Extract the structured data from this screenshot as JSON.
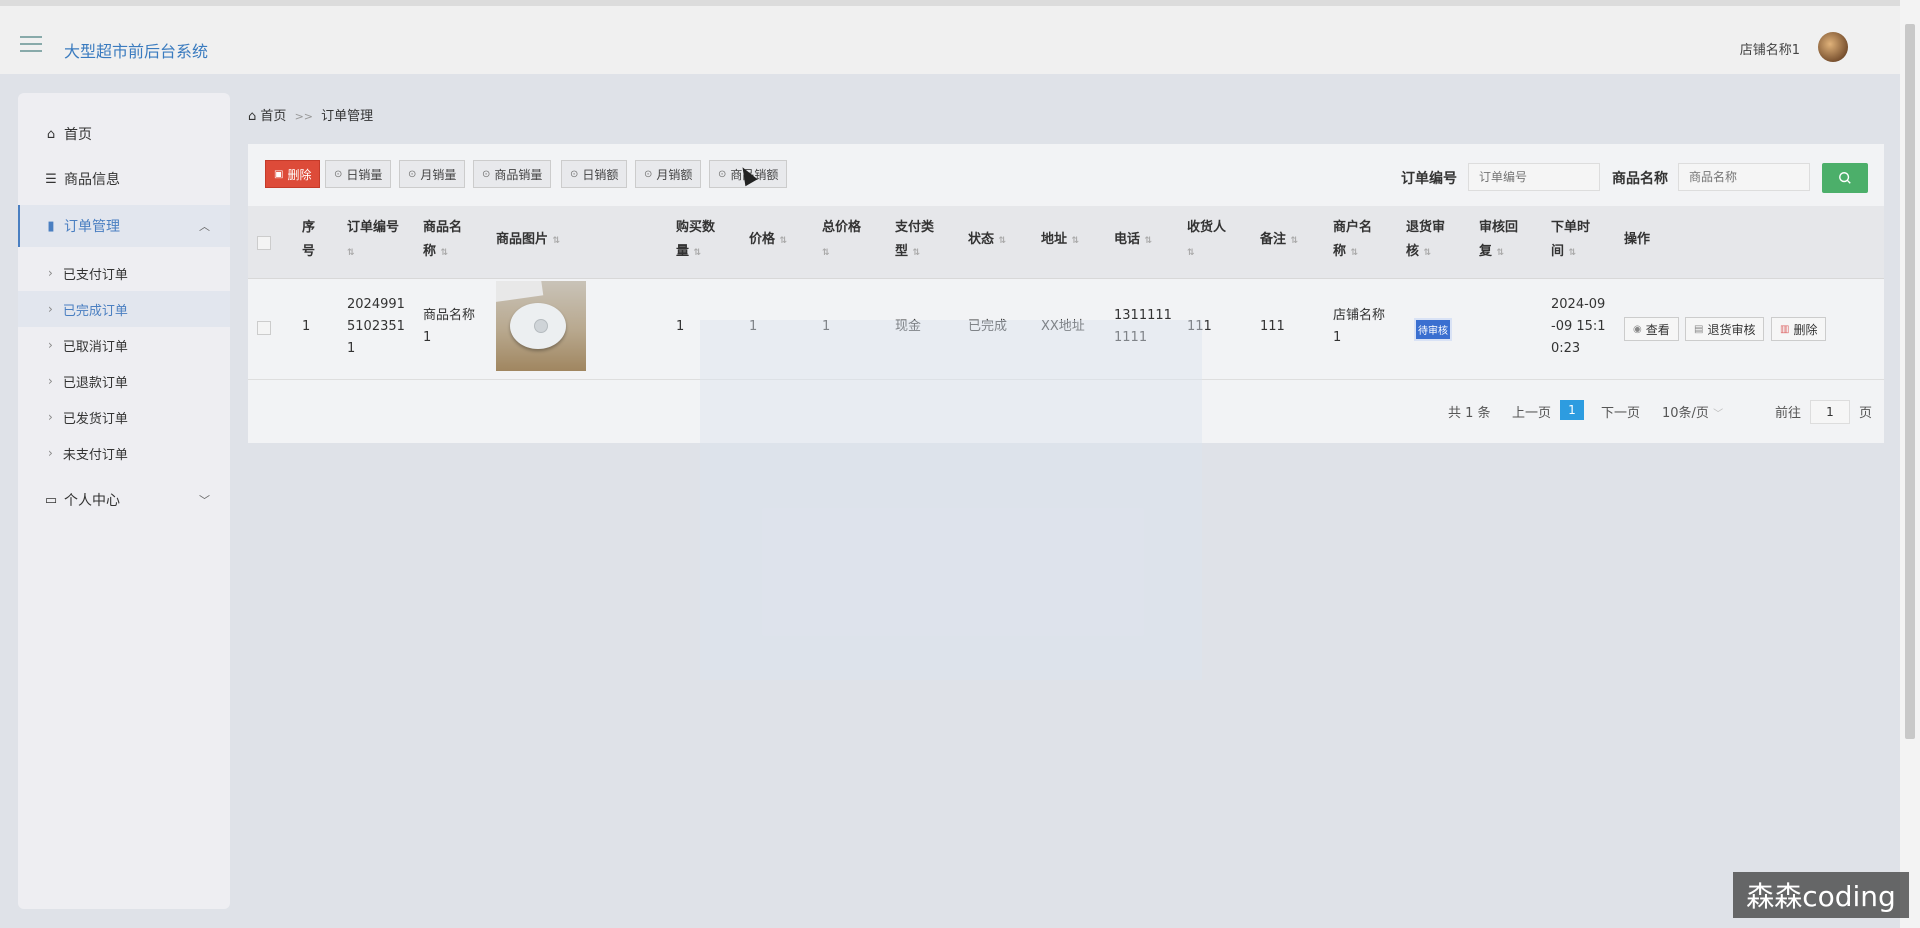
{
  "header": {
    "title": "大型超市前后台系统",
    "shop_name": "店铺名称1"
  },
  "sidebar": {
    "home": "首页",
    "product_info": "商品信息",
    "order_mgmt": "订单管理",
    "sub_items": [
      "已支付订单",
      "已完成订单",
      "已取消订单",
      "已退款订单",
      "已发货订单",
      "未支付订单"
    ],
    "personal": "个人中心"
  },
  "breadcrumb": {
    "home": "首页",
    "sep": ">>",
    "current": "订单管理"
  },
  "toolbar": {
    "delete": "删除",
    "daily_sales": "日销量",
    "monthly_sales": "月销量",
    "product_sales": "商品销量",
    "daily_revenue": "日销额",
    "monthly_revenue": "月销额",
    "product_revenue": "商品销额"
  },
  "search": {
    "order_no_label": "订单编号",
    "order_no_placeholder": "订单编号",
    "product_name_label": "商品名称",
    "product_name_placeholder": "商品名称"
  },
  "table": {
    "headers": {
      "seq": [
        "序",
        "号"
      ],
      "order_no": "订单编号",
      "product_name": [
        "商品名",
        "称"
      ],
      "product_image": "商品图片",
      "quantity": [
        "购买数",
        "量"
      ],
      "price": "价格",
      "total_price": "总价格",
      "pay_type": [
        "支付类",
        "型"
      ],
      "status": "状态",
      "address": "地址",
      "phone": "电话",
      "receiver": "收货人",
      "remark": "备注",
      "merchant": [
        "商户名",
        "称"
      ],
      "return_review": [
        "退货审",
        "核"
      ],
      "review_reply": [
        "审核回",
        "复"
      ],
      "order_time": [
        "下单时",
        "间"
      ],
      "actions": "操作"
    },
    "rows": [
      {
        "seq": "1",
        "order_no": [
          "2024991",
          "5102351",
          "1"
        ],
        "product_name": [
          "商品名称",
          "1"
        ],
        "quantity": "1",
        "price": "1",
        "total_price": "1",
        "pay_type": "现金",
        "status": "已完成",
        "address": "XX地址",
        "phone": [
          "1311111",
          "1111"
        ],
        "receiver": "111",
        "remark": "111",
        "merchant": [
          "店铺名称",
          "1"
        ],
        "return_review": "待审核",
        "order_time": [
          "2024-09",
          "-09 15:1",
          "0:23"
        ],
        "view": "查看",
        "review": "退货审核",
        "delete": "删除"
      }
    ]
  },
  "pagination": {
    "total": "共 1 条",
    "prev": "上一页",
    "current": "1",
    "next": "下一页",
    "page_size": "10条/页",
    "goto": "前往",
    "goto_value": "1",
    "page_unit": "页"
  },
  "watermark": "森森coding",
  "colors": {
    "accent": "#4a7fc1",
    "danger": "#dd4b39",
    "search_button": "#4caf6a",
    "badge": "#3a6fd0",
    "pager_active": "#2d9ce0"
  }
}
